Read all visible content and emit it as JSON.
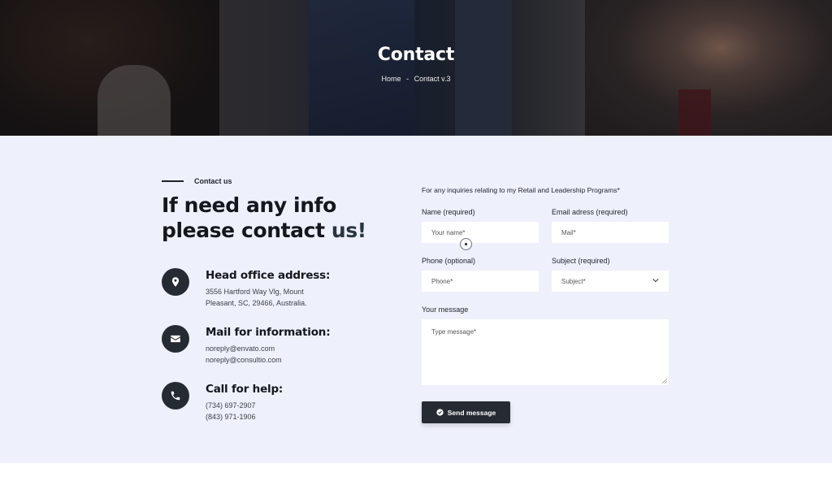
{
  "hero": {
    "title": "Contact",
    "breadcrumb": {
      "home": "Home",
      "separator": "-",
      "current": "Contact v.3"
    }
  },
  "contact": {
    "eyebrow": "Contact us",
    "headline_part1": "If need any info please contact ",
    "headline_accent": "us!",
    "items": [
      {
        "icon": "location-pin-icon",
        "title": "Head office address:",
        "line1": "3556 Hartford Way Vlg, Mount",
        "line2": "Pleasant, SC, 29466, Australia."
      },
      {
        "icon": "envelope-icon",
        "title": "Mail for information:",
        "line1": "noreply@envato.com",
        "line2": "noreply@consultio.com"
      },
      {
        "icon": "phone-icon",
        "title": "Call for help:",
        "line1": "(734) 697-2907",
        "line2": "(843) 971-1906"
      }
    ]
  },
  "form": {
    "intro": "For any inquiries relating to my Retail and Leadership Programs*",
    "name_label": "Name (required)",
    "name_placeholder": "Your name*",
    "email_label": "Email adress (required)",
    "email_placeholder": "Mail*",
    "phone_label": "Phone (optional)",
    "phone_placeholder": "Phone*",
    "subject_label": "Subject (required)",
    "subject_value": "Subject*",
    "message_label": "Your message",
    "message_placeholder": "Type message*",
    "send_label": "Send message"
  },
  "colors": {
    "section_bg": "#eef0fb",
    "dark": "#262b33",
    "heading": "#14171c"
  }
}
